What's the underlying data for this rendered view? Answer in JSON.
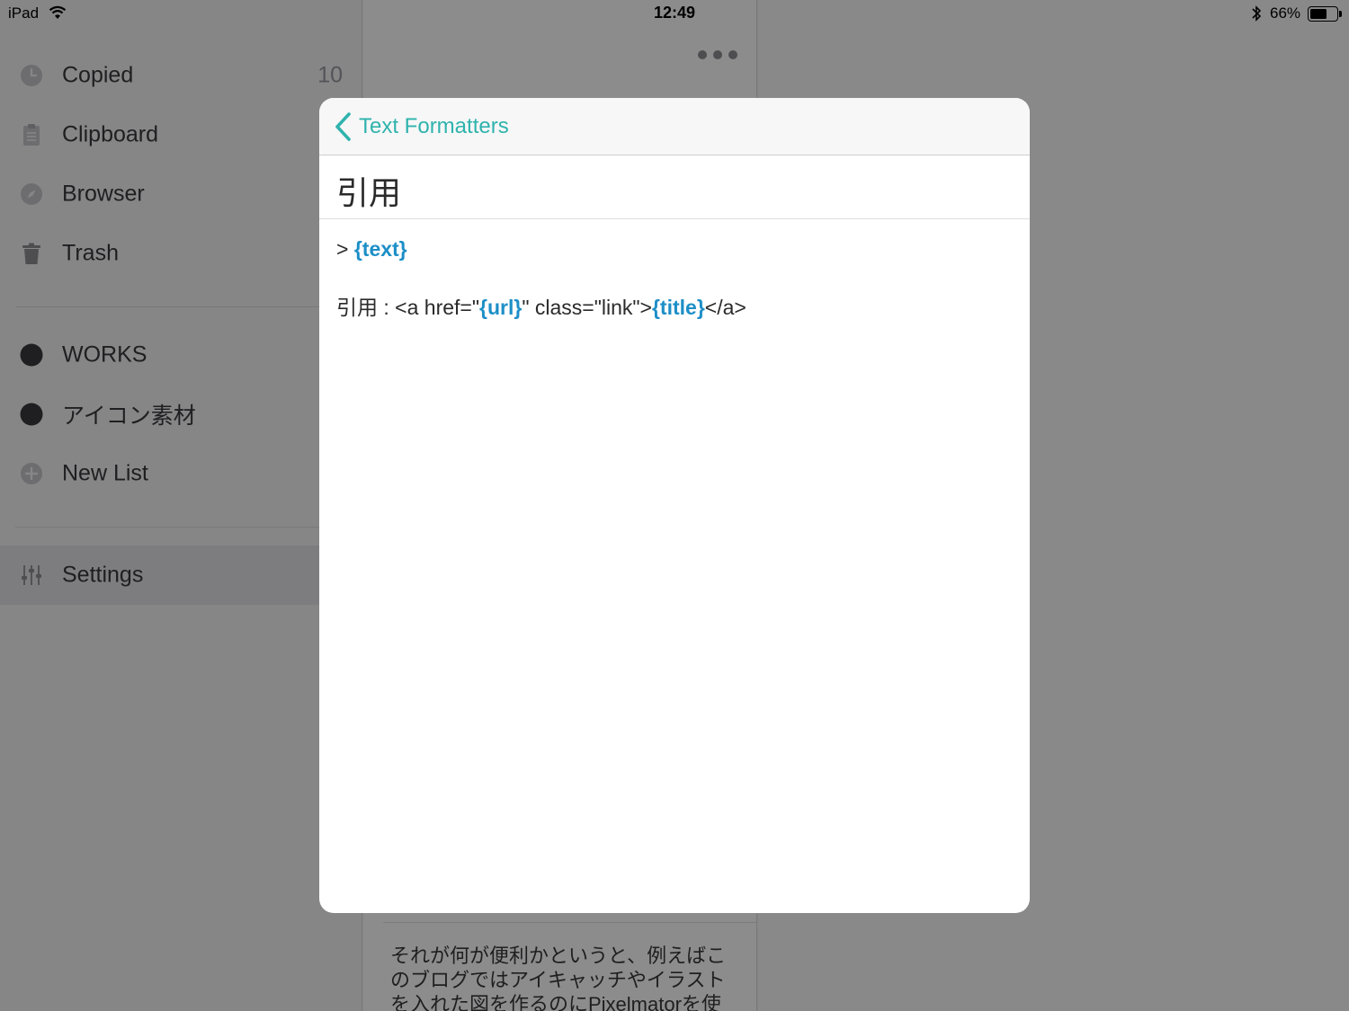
{
  "status_bar": {
    "device": "iPad",
    "time": "12:49",
    "battery_text": "66%",
    "battery_level": 0.66,
    "icons": [
      "wifi-icon",
      "bluetooth-icon",
      "battery-icon"
    ]
  },
  "sidebar": {
    "items": [
      {
        "label": "Copied",
        "count": "10",
        "icon": "clock-icon"
      },
      {
        "label": "Clipboard",
        "icon": "clipboard-icon"
      },
      {
        "label": "Browser",
        "icon": "compass-icon"
      },
      {
        "label": "Trash",
        "icon": "trash-icon"
      }
    ],
    "lists": [
      {
        "label": "WORKS",
        "icon": "circle-icon",
        "color": "#3a3a3c"
      },
      {
        "label": "アイコン素材",
        "icon": "circle-icon",
        "color": "#3a3a3c"
      },
      {
        "label": "New List",
        "icon": "plus-circle-icon"
      }
    ],
    "settings": {
      "label": "Settings",
      "icon": "sliders-icon"
    }
  },
  "middle_pane": {
    "more_icon": "ellipsis-icon",
    "preview_lines": [
      "それが何が便利かというと、例えばこ",
      "のブログではアイキャッチやイラスト",
      "を入れた図を作るのにPixelmatorを使"
    ]
  },
  "modal": {
    "back_label": "Text Formatters",
    "back_icon": "chevron-left-icon",
    "title": "引用",
    "line1": {
      "prefix": "> ",
      "placeholder": "{text}"
    },
    "line2": {
      "seg1": "引用 : <a href=\"",
      "ph_url": "{url}",
      "seg2": "\" class=\"link\">",
      "ph_title": "{title}",
      "seg3": "</a>"
    }
  },
  "colors": {
    "accent": "#2fb3ad",
    "placeholder": "#1d8fc7",
    "overlay": "rgba(0,0,0,0.45)"
  }
}
